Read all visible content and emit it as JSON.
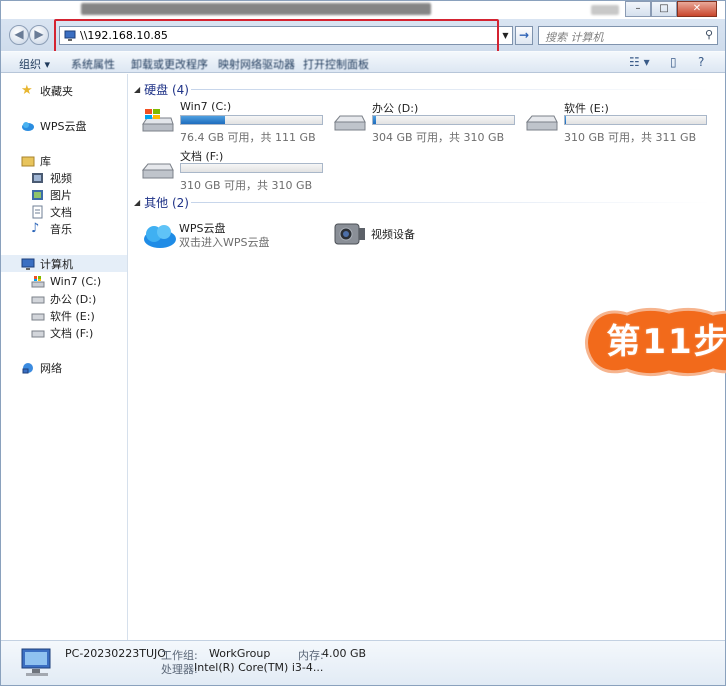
{
  "address": {
    "path": "\\\\192.168.10.85",
    "search_placeholder": "搜索 计算机"
  },
  "toolbar": {
    "organize": "组织 ▾",
    "system_properties": "系统属性",
    "uninstall": "卸载或更改程序",
    "map_drive": "映射网络驱动器",
    "control_panel": "打开控制面板"
  },
  "sidebar": {
    "favorites": "收藏夹",
    "wps_cloud": "WPS云盘",
    "library": "库",
    "videos": "视频",
    "pictures": "图片",
    "documents": "文档",
    "music": "音乐",
    "computer": "计算机",
    "drive_c": "Win7 (C:)",
    "drive_d": "办公 (D:)",
    "drive_e": "软件 (E:)",
    "drive_f": "文档 (F:)",
    "network": "网络"
  },
  "main": {
    "hard_disks_header": "硬盘 (4)",
    "drives": [
      {
        "name": "Win7 (C:)",
        "free": "76.4 GB 可用，共 111 GB",
        "used_fraction": 0.31
      },
      {
        "name": "办公 (D:)",
        "free": "304 GB 可用，共 310 GB",
        "used_fraction": 0.02
      },
      {
        "name": "软件 (E:)",
        "free": "310 GB 可用，共 311 GB",
        "used_fraction": 0.005
      },
      {
        "name": "文档 (F:)",
        "free": "310 GB 可用，共 310 GB",
        "used_fraction": 0.0
      }
    ],
    "other_header": "其他 (2)",
    "wps_name": "WPS云盘",
    "wps_sub": "双击进入WPS云盘",
    "video_device": "视频设备",
    "step_badge": "第11步"
  },
  "status": {
    "pc_name": "PC-20230223TUJO",
    "workgroup_label": "工作组:",
    "workgroup_value": "WorkGroup",
    "memory_label": "内存:",
    "memory_value": "4.00 GB",
    "cpu_label": "处理器:",
    "cpu_value": "Intel(R) Core(TM) i3-4..."
  },
  "colors": {
    "accent_red": "#d42331",
    "badge_orange": "#f26a1b",
    "link_blue": "#1e3287",
    "drive_bar": "#1e6cbe"
  }
}
